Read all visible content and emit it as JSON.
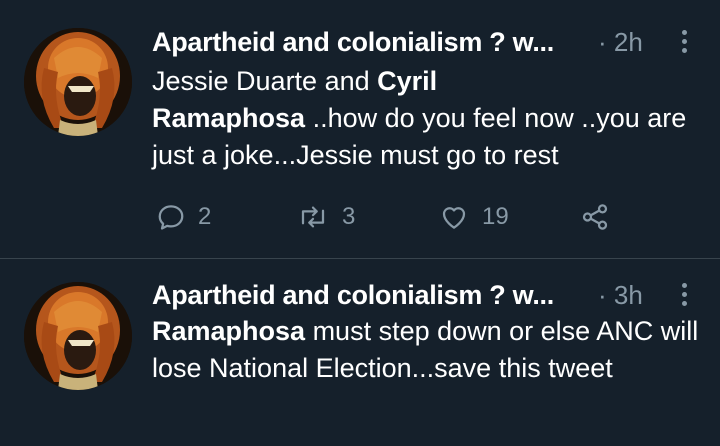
{
  "tweets": [
    {
      "author": "Apartheid and colonialism ? w...",
      "time": "· 2h",
      "text_parts": [
        {
          "t": "Jessie Duarte and ",
          "bold": false
        },
        {
          "t": "Cyril",
          "bold": true
        },
        {
          "t": "Ramaphosa",
          "bold": true
        },
        {
          "t": " ..how do you feel now ..you are just a joke...Jessie must go to rest",
          "bold": false
        }
      ],
      "replies": "2",
      "retweets": "3",
      "likes": "19"
    },
    {
      "author": "Apartheid and colonialism ? w...",
      "time": "· 3h",
      "text_parts": [
        {
          "t": "Ramaphosa",
          "bold": true
        },
        {
          "t": " must step down or else ANC will lose National Election...save this tweet",
          "bold": false
        }
      ]
    }
  ],
  "colors": {
    "background": "#15202b",
    "secondary_text": "#8899a6",
    "divider": "#38444d"
  },
  "icons": [
    "more-vertical-icon",
    "reply-icon",
    "retweet-icon",
    "like-icon",
    "share-icon"
  ]
}
